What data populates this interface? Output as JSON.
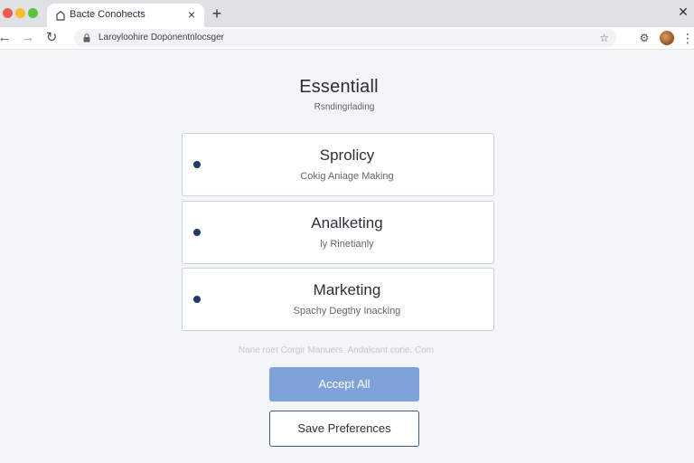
{
  "browser": {
    "tab_title": "Bacte Conohects",
    "url": "Laroyloohire Doponentnlocsger",
    "back_glyph": "←",
    "forward_glyph": "→",
    "reload_glyph": "↻",
    "close_glyph": "×",
    "new_tab_glyph": "+",
    "window_close_glyph": "✕",
    "star_glyph": "☆",
    "extension_glyph": "⚙",
    "menu_glyph": "⋮",
    "icons": [
      "back-icon",
      "forward-icon",
      "reload-icon",
      "lock-icon",
      "star-icon",
      "extension-icon",
      "avatar",
      "menu-icon"
    ]
  },
  "page": {
    "title": "Essentiall",
    "subtitle": "Rsndingrlading"
  },
  "options": [
    {
      "title": "Sprolicy",
      "description": "Cokig Aniage Making"
    },
    {
      "title": "Analketing",
      "description": "ly Rinetianly"
    },
    {
      "title": "Marketing",
      "description": "Spachy Degthy Inacking"
    }
  ],
  "footnote": "Nane roet Corgir Manuers. Andalcant corie, Com",
  "buttons": {
    "accept_all": "Accept All",
    "save_preferences": "Save Preferences"
  },
  "colors": {
    "accent": "#7fa3d8",
    "radio": "#1f3a68",
    "card_border": "#c9d2e3",
    "save_border": "#3d5a86"
  }
}
